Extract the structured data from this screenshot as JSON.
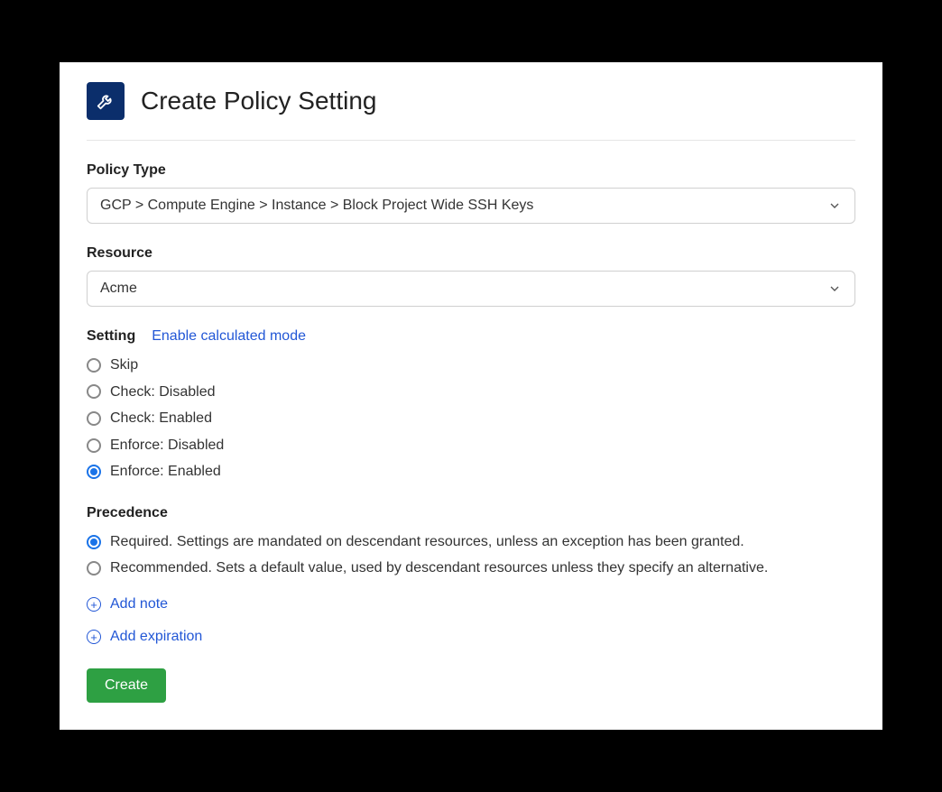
{
  "header": {
    "title": "Create Policy Setting"
  },
  "policyType": {
    "label": "Policy Type",
    "value": "GCP > Compute Engine > Instance > Block Project Wide SSH Keys"
  },
  "resource": {
    "label": "Resource",
    "value": "Acme"
  },
  "setting": {
    "label": "Setting",
    "calcLink": "Enable calculated mode",
    "options": [
      {
        "label": "Skip",
        "selected": false
      },
      {
        "label": "Check: Disabled",
        "selected": false
      },
      {
        "label": "Check: Enabled",
        "selected": false
      },
      {
        "label": "Enforce: Disabled",
        "selected": false
      },
      {
        "label": "Enforce: Enabled",
        "selected": true
      }
    ]
  },
  "precedence": {
    "label": "Precedence",
    "options": [
      {
        "label": "Required. Settings are mandated on descendant resources, unless an exception has been granted.",
        "selected": true
      },
      {
        "label": "Recommended. Sets a default value, used by descendant resources unless they specify an alternative.",
        "selected": false
      }
    ]
  },
  "addNote": "Add note",
  "addExpiration": "Add expiration",
  "createButton": "Create"
}
